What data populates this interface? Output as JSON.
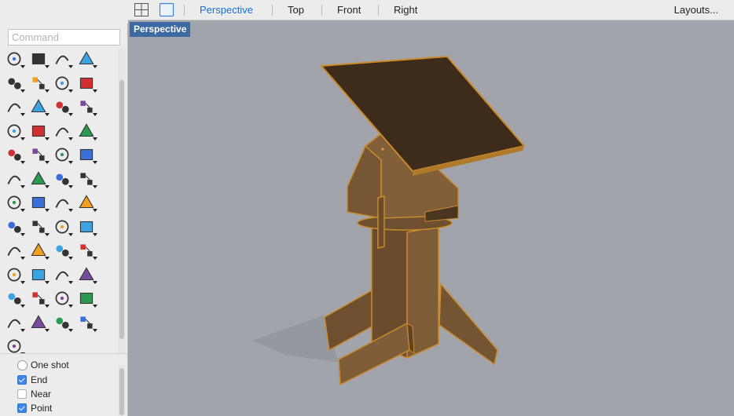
{
  "command": {
    "placeholder": "Command",
    "value": ""
  },
  "viewport_tabs": [
    {
      "label": "Perspective",
      "active": true
    },
    {
      "label": "Top",
      "active": false
    },
    {
      "label": "Front",
      "active": false
    },
    {
      "label": "Right",
      "active": false
    }
  ],
  "layouts_label": "Layouts...",
  "viewport": {
    "title": "Perspective"
  },
  "osnap": {
    "one_shot": {
      "label": "One shot",
      "checked": false
    },
    "items": [
      {
        "label": "End",
        "checked": true
      },
      {
        "label": "Near",
        "checked": false
      },
      {
        "label": "Point",
        "checked": true
      }
    ]
  },
  "toolbar_icons": [
    [
      "circle-icon",
      "ellipse-icon",
      "arc-icon",
      "rectangle-icon"
    ],
    [
      "polygon-icon",
      "curve-icon",
      "surface-icon",
      "sweep-icon"
    ],
    [
      "box-icon",
      "sphere-icon",
      "cylinder-icon",
      "mesh-icon"
    ],
    [
      "explode-icon",
      "boolean-icon",
      "trim-icon",
      "split-icon"
    ],
    [
      "solid-union-icon",
      "points-icon",
      "fillet-icon",
      "offset-icon"
    ],
    [
      "text-icon",
      "scale-icon",
      "group-icon",
      "mirror-icon"
    ],
    [
      "block-icon",
      "array-icon",
      "grid-array-icon",
      "align-icon"
    ],
    [
      "analyze-icon",
      "check-icon",
      "render-icon",
      "dimension-icon"
    ],
    [
      "zoom-window-icon",
      "zoom-extents-icon",
      "zoom-selected-icon",
      "zoom-icon"
    ],
    [
      "rotate-view-icon",
      "car-icon",
      "plane-icon",
      "snap-icon"
    ],
    [
      "light-icon",
      "lock-icon",
      "material-icon",
      "color-wheel-icon"
    ],
    [
      "display-mode-icon",
      "wireframe-icon",
      "rendered-sphere-icon",
      "cone-icon"
    ],
    [
      "history-icon"
    ]
  ],
  "colors": {
    "viewport_bg": "#a1a4aa",
    "accent": "#1b6fd6",
    "viewport_label_bg": "#3d6aa3",
    "wood": "#7a5a36",
    "wood_edge": "#c98a2c",
    "top_panel": "#3b2a1a"
  }
}
